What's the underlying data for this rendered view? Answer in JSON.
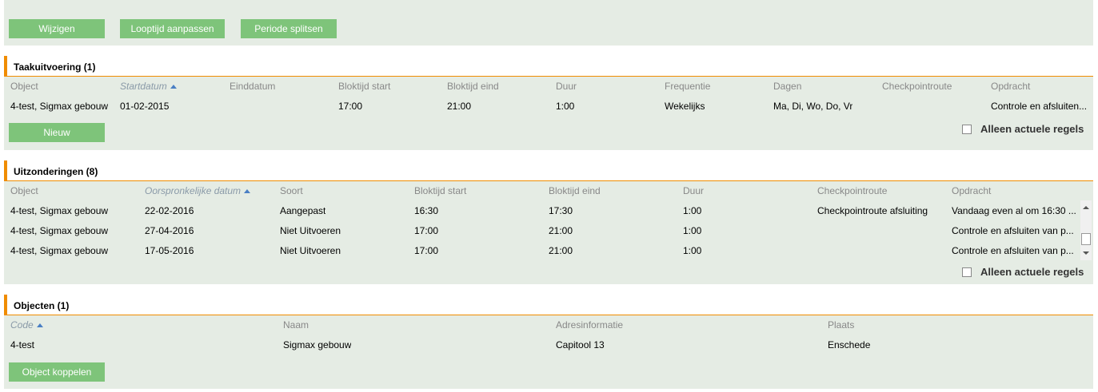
{
  "toolbar": {
    "edit_label": "Wijzigen",
    "duration_label": "Looptijd aanpassen",
    "split_label": "Periode splitsen"
  },
  "tasks": {
    "title": "Taakuitvoering (1)",
    "columns": [
      "Object",
      "Startdatum",
      "Einddatum",
      "Bloktijd start",
      "Bloktijd eind",
      "Duur",
      "Frequentie",
      "Dagen",
      "Checkpointroute",
      "Opdracht"
    ],
    "rows": [
      [
        "4-test, Sigmax gebouw",
        "01-02-2015",
        "",
        "17:00",
        "21:00",
        "1:00",
        "Wekelijks",
        "Ma, Di, Wo, Do, Vr",
        "",
        "Controle en afsluiten..."
      ]
    ],
    "new_label": "Nieuw",
    "current_only_label": "Alleen actuele regels"
  },
  "exceptions": {
    "title": "Uitzonderingen (8)",
    "columns": [
      "Object",
      "Oorspronkelijke datum",
      "Soort",
      "Bloktijd start",
      "Bloktijd eind",
      "Duur",
      "Checkpointroute",
      "Opdracht"
    ],
    "rows": [
      [
        "4-test, Sigmax gebouw",
        "22-02-2016",
        "Aangepast",
        "16:30",
        "17:30",
        "1:00",
        "Checkpointroute afsluiting",
        "Vandaag even al om 16:30 ..."
      ],
      [
        "4-test, Sigmax gebouw",
        "27-04-2016",
        "Niet Uitvoeren",
        "17:00",
        "21:00",
        "1:00",
        "",
        "Controle en afsluiten van p..."
      ],
      [
        "4-test, Sigmax gebouw",
        "17-05-2016",
        "Niet Uitvoeren",
        "17:00",
        "21:00",
        "1:00",
        "",
        "Controle en afsluiten van p..."
      ]
    ],
    "current_only_label": "Alleen actuele regels"
  },
  "objects": {
    "title": "Objecten (1)",
    "columns": [
      "Code",
      "Naam",
      "Adresinformatie",
      "Plaats"
    ],
    "rows": [
      [
        "4-test",
        "Sigmax gebouw",
        "Capitool 13",
        "Enschede"
      ]
    ],
    "link_label": "Object koppelen"
  },
  "colors": {
    "accent": "#f08c00",
    "button": "#7ec47a",
    "panel": "#e5ece4"
  }
}
